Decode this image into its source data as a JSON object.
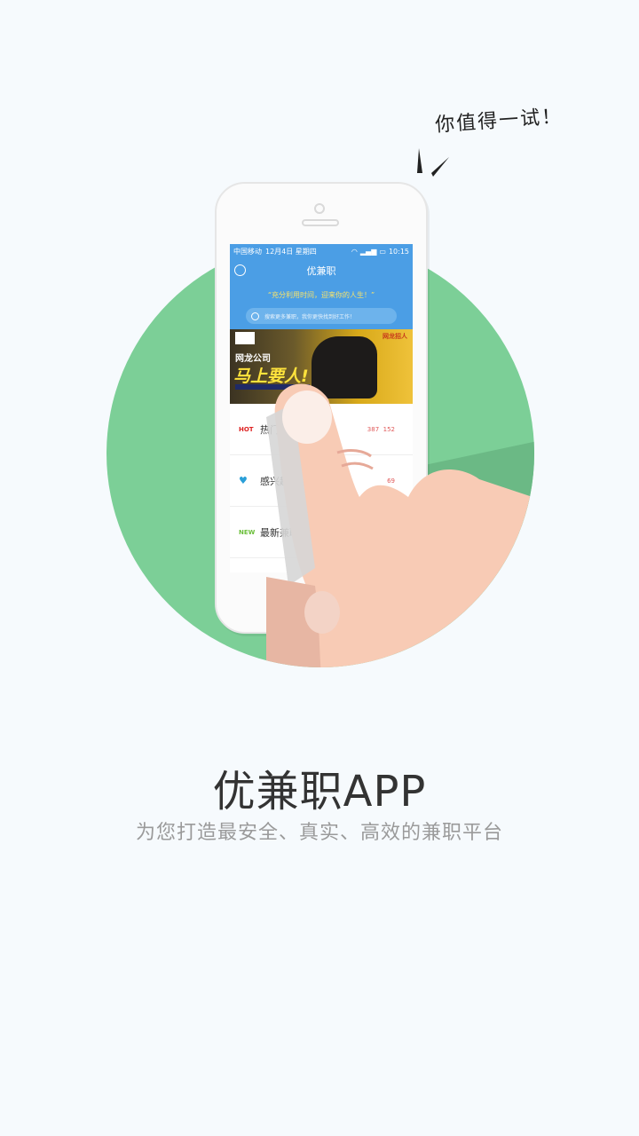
{
  "hero": {
    "callout": "你值得一试！",
    "title": "优兼职APP",
    "subtitle": "为您打造最安全、真实、高效的兼职平台"
  },
  "phone": {
    "status_bar": {
      "carrier": "中国移动",
      "date": "12月4日 星期四",
      "time": "10:15"
    },
    "app_title": "优兼职",
    "slogan": "“充分利用时间，迎来你的人生！”",
    "search_placeholder": "搜索更多兼职，我你更快找到好工作！",
    "banner": {
      "company": "网龙公司",
      "headline": "马上要人!",
      "tag": "网龙招人"
    },
    "list": [
      {
        "icon": "HOT",
        "label": "热门",
        "stat_a": "387",
        "stat_b": "152"
      },
      {
        "icon": "heart-icon",
        "label": "感兴趣的",
        "stat_a": "",
        "stat_b": "69"
      },
      {
        "icon": "NEW",
        "label": "最新兼职",
        "stat_a": "",
        "stat_b": ""
      }
    ]
  },
  "colors": {
    "circle": "#7ccf97",
    "app_blue": "#4b9ee5",
    "background": "#f6fafd"
  }
}
